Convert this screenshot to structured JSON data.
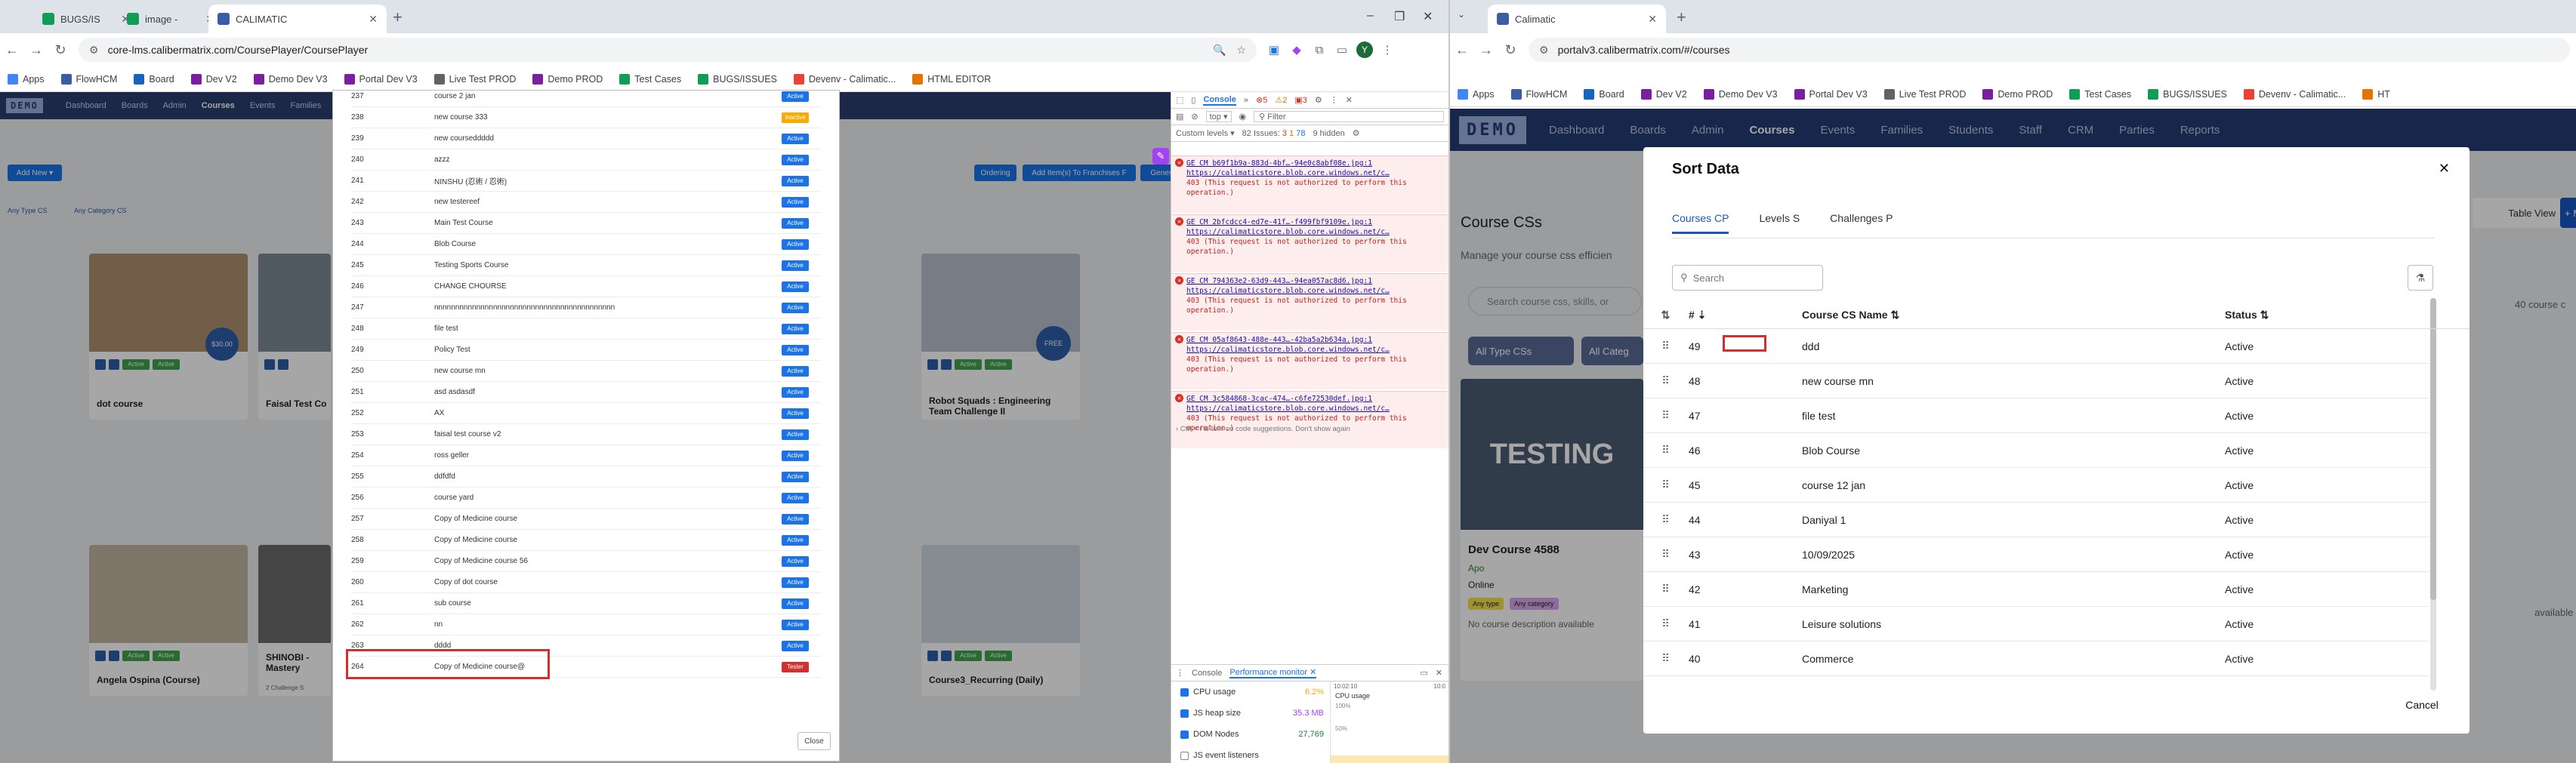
{
  "left_window": {
    "tabs": [
      {
        "label": "BUGS/IS",
        "favicon_color": "#0f9d58"
      },
      {
        "label": "image -",
        "favicon_color": "#0f9d58"
      },
      {
        "label": "CALIMATIC",
        "favicon_color": "#3b5ba5"
      }
    ],
    "url": "core-lms.calibermatrix.com/CoursePlayer/CoursePlayer",
    "profile_initial": "Y",
    "bookmarks": [
      "Apps",
      "FlowHCM",
      "Board",
      "Dev V2",
      "Demo Dev V3",
      "Portal Dev V3",
      "Live Test PROD",
      "Demo PROD",
      "Test Cases",
      "BUGS/ISSUES",
      "Devenv - Calimatic...",
      "HTML EDITOR"
    ],
    "app": {
      "logo": "DEMO",
      "nav": [
        "Dashboard",
        "Boards",
        "Admin",
        "Courses",
        "Events",
        "Families"
      ],
      "active_nav": "Courses",
      "user": "user_image",
      "add_new": "Add New",
      "filter_type": "Any Type CS",
      "filter_cat": "Any Category CS",
      "buttons": [
        "Ordering",
        "Add Item(s) To Franchises F",
        "Generate Market Place Script"
      ],
      "cards": [
        {
          "title": "dot course",
          "price": "$30.00"
        },
        {
          "title": "Faisal Test Co",
          "price": ""
        },
        {
          "title": "Robot Squads : Engineering Team Challenge II",
          "price": "FREE"
        },
        {
          "title": "Angela Ospina (Course)",
          "price": ""
        },
        {
          "title": "SHINOBI - Mastery",
          "price": ""
        },
        {
          "title": "Course3_Recurring (Daily)",
          "price": ""
        }
      ],
      "card_badge": "Active",
      "challenge_text": "2 Challenge S"
    },
    "modal": {
      "rows": [
        {
          "n": "237",
          "name": "course 2 jan",
          "status": "Active"
        },
        {
          "n": "238",
          "name": "new course 333",
          "status": "Inactive"
        },
        {
          "n": "239",
          "name": "new courseddddd",
          "status": "Active"
        },
        {
          "n": "240",
          "name": "azzz",
          "status": "Active"
        },
        {
          "n": "241",
          "name": "NINSHU (忍術 / 忍術)",
          "status": "Active"
        },
        {
          "n": "242",
          "name": "new testereef",
          "status": "Active"
        },
        {
          "n": "243",
          "name": "Main Test Course",
          "status": "Active"
        },
        {
          "n": "244",
          "name": "Blob Course",
          "status": "Active"
        },
        {
          "n": "245",
          "name": "Testing Sports Course",
          "status": "Active"
        },
        {
          "n": "246",
          "name": "CHANGE CHOURSE",
          "status": "Active"
        },
        {
          "n": "247",
          "name": "nnnnnnnnnnnnnnnnnnnnnnnnnnnnnnnnnnnnnnnnnnn",
          "status": "Active"
        },
        {
          "n": "248",
          "name": "file test",
          "status": "Active"
        },
        {
          "n": "249",
          "name": "Policy Test",
          "status": "Active"
        },
        {
          "n": "250",
          "name": "new course mn",
          "status": "Active"
        },
        {
          "n": "251",
          "name": "asd asdasdf",
          "status": "Active"
        },
        {
          "n": "252",
          "name": "AX",
          "status": "Active"
        },
        {
          "n": "253",
          "name": "faisal test course v2",
          "status": "Active"
        },
        {
          "n": "254",
          "name": "ross geller",
          "status": "Active"
        },
        {
          "n": "255",
          "name": "ddfdfd",
          "status": "Active"
        },
        {
          "n": "256",
          "name": "course yard",
          "status": "Active"
        },
        {
          "n": "257",
          "name": "Copy of Medicine course",
          "status": "Active"
        },
        {
          "n": "258",
          "name": "Copy of Medicine course",
          "status": "Active"
        },
        {
          "n": "259",
          "name": "Copy of Medicine course 56",
          "status": "Active"
        },
        {
          "n": "260",
          "name": "Copy of dot course",
          "status": "Active"
        },
        {
          "n": "261",
          "name": "sub course",
          "status": "Active"
        },
        {
          "n": "262",
          "name": "nn",
          "status": "Active"
        },
        {
          "n": "263",
          "name": "dddd",
          "status": "Active"
        },
        {
          "n": "264",
          "name": "Copy of Medicine course@",
          "status": "Tester"
        }
      ],
      "close": "Close"
    },
    "devtools": {
      "tab": "Console",
      "errors_count": "5",
      "warn_count": "2",
      "info_count": "3",
      "context": "top",
      "filter": "Filter",
      "levels": "Custom levels",
      "issues": "82 Issues:",
      "issue_counts": [
        "3",
        "1",
        "78"
      ],
      "hidden": "9 hidden",
      "errors": [
        {
          "file": "GE CM b69f1b9a-883d-4bf…-94e0c8abf08e.jpg:1",
          "url": "https://calimaticstore.blob.core.windows.net/c…",
          "msg": "403 (This request is not authorized to perform this operation.)"
        },
        {
          "file": "GE CM 2bfcdcc4-ed7e-41f…-f499fbf9109e.jpg:1",
          "url": "https://calimaticstore.blob.core.windows.net/c…",
          "msg": "403 (This request is not authorized to perform this operation.)"
        },
        {
          "file": "GE CM 794363e2-63d9-443…-94ea057ac8d6.jpg:1",
          "url": "https://calimaticstore.blob.core.windows.net/c…",
          "msg": "403 (This request is not authorized to perform this operation.)"
        },
        {
          "file": "GE CM 05af8643-488e-443…-42ba5a2b634a.jpg:1",
          "url": "https://calimaticstore.blob.core.windows.net/c…",
          "msg": "403 (This request is not authorized to perform this operation.)"
        },
        {
          "file": "GE CM 3c584868-3cac-474…-c6fe72530def.jpg:1",
          "url": "https://calimaticstore.blob.core.windows.net/c…",
          "msg": "403 (This request is not authorized to perform this operation.)"
        }
      ],
      "hint": "Ctrl + i to turn on code suggestions. Don't show again",
      "drawer_tabs": [
        "Console",
        "Performance monitor"
      ],
      "perf": [
        {
          "label": "CPU usage",
          "value": "6.2%",
          "color": "#f9ab00",
          "on": true
        },
        {
          "label": "JS heap size",
          "value": "35.3 MB",
          "color": "#a142f4",
          "on": true
        },
        {
          "label": "DOM Nodes",
          "value": "27,769",
          "color": "#188038",
          "on": true
        },
        {
          "label": "JS event listeners",
          "value": "",
          "color": "#1a73e8",
          "on": false
        }
      ],
      "graph_label": "CPU usage",
      "graph_pct": [
        "100%",
        "50%"
      ],
      "graph_times": [
        "10:02:10",
        "10:0"
      ]
    }
  },
  "right_window": {
    "tab": "Calimatic",
    "url": "portalv3.calibermatrix.com/#/courses",
    "bookmarks": [
      "Apps",
      "FlowHCM",
      "Board",
      "Dev V2",
      "Demo Dev V3",
      "Portal Dev V3",
      "Live Test PROD",
      "Demo PROD",
      "Test Cases",
      "BUGS/ISSUES",
      "Devenv - Calimatic...",
      "HT"
    ],
    "app": {
      "logo": "DEMO",
      "nav": [
        "Dashboard",
        "Boards",
        "Admin",
        "Courses",
        "Events",
        "Families",
        "Students",
        "Staff",
        "CRM",
        "Parties",
        "Reports"
      ],
      "page_title": "Course CSs",
      "page_sub": "Manage your course css efficien",
      "search_ph": "Search course css, skills, or",
      "filter_type": "All Type CSs",
      "filter_cat": "All Categ",
      "table_view": "Table View",
      "count_text": "40 course c",
      "card_title": "Dev Course 4588",
      "card_cat": "Apo",
      "card_status": "Online",
      "card_tags": [
        "Any type",
        "Any category"
      ],
      "card_desc": "No course description available",
      "right_text": "available",
      "card_img_text": "TESTING"
    },
    "sort_modal": {
      "title": "Sort Data",
      "tabs": [
        "Courses CP",
        "Levels S",
        "Challenges P"
      ],
      "active_tab": "Courses CP",
      "search_ph": "Search",
      "columns": [
        "#",
        "Course CS Name",
        "Status"
      ],
      "rows": [
        {
          "n": "49",
          "name": "ddd",
          "status": "Active"
        },
        {
          "n": "48",
          "name": "new course mn",
          "status": "Active"
        },
        {
          "n": "47",
          "name": "file test",
          "status": "Active"
        },
        {
          "n": "46",
          "name": "Blob Course",
          "status": "Active"
        },
        {
          "n": "45",
          "name": "course 12 jan",
          "status": "Active"
        },
        {
          "n": "44",
          "name": "Daniyal 1",
          "status": "Active"
        },
        {
          "n": "43",
          "name": "10/09/2025",
          "status": "Active"
        },
        {
          "n": "42",
          "name": "Marketing",
          "status": "Active"
        },
        {
          "n": "41",
          "name": "Leisure solutions",
          "status": "Active"
        },
        {
          "n": "40",
          "name": "Commerce",
          "status": "Active"
        }
      ],
      "cancel": "Cancel"
    }
  }
}
